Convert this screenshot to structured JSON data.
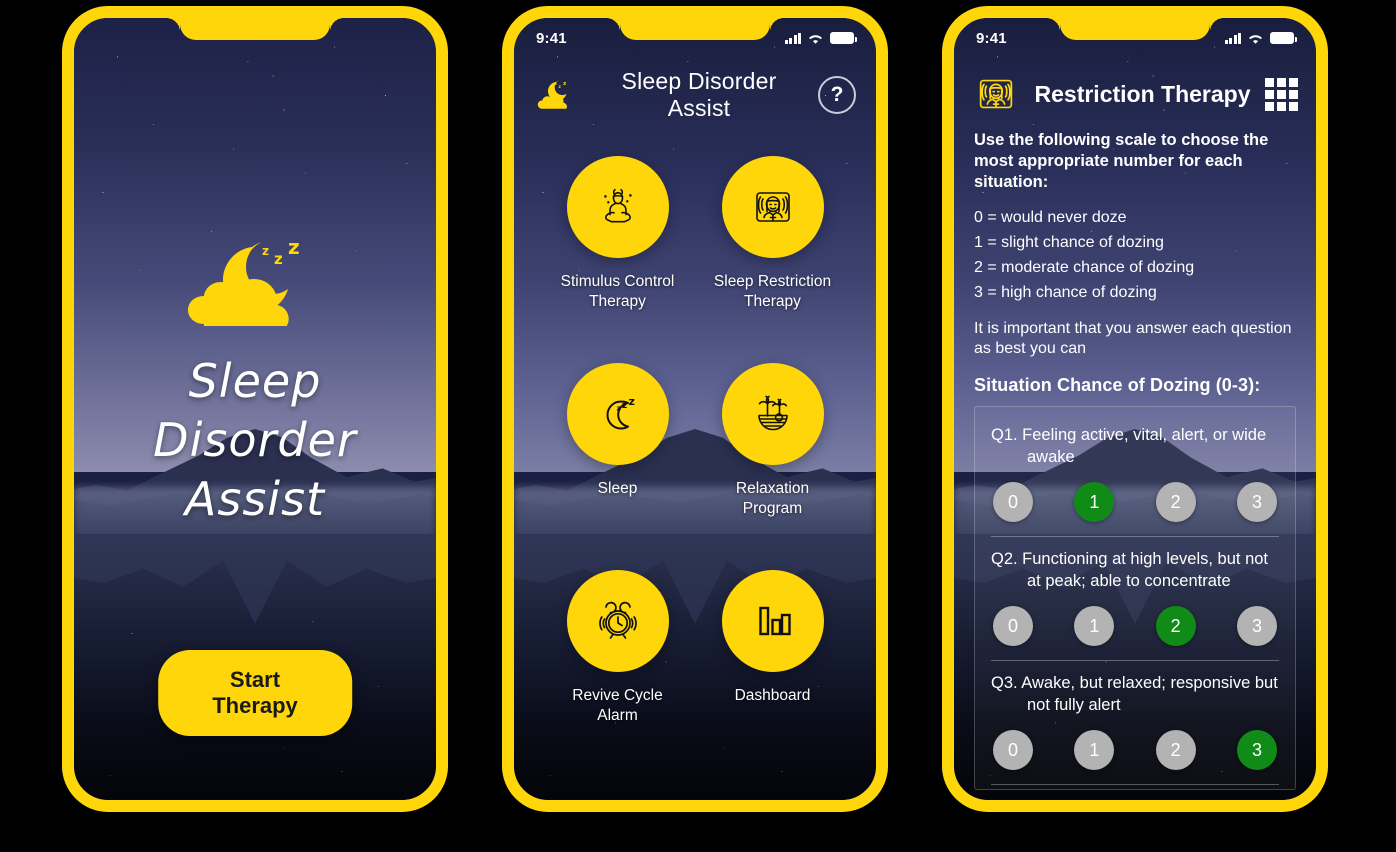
{
  "brand": {
    "yellow": "#FFD60A",
    "green": "#118B18",
    "grey": "#B3B3B3"
  },
  "phone1": {
    "status": {
      "time": "",
      "signal_icon": "signal-bars-icon",
      "wifi_icon": "wifi-icon",
      "battery_icon": "battery-icon"
    },
    "logo_icon": "sleep-cloud-moon-logo",
    "title": "Sleep Disorder\nAssist",
    "title_line1": "Sleep Disorder",
    "title_line2": "Assist",
    "cta_label": "Start Therapy"
  },
  "phone2": {
    "status": {
      "time": "9:41",
      "signal_icon": "signal-bars-icon",
      "wifi_icon": "wifi-icon",
      "battery_icon": "battery-icon"
    },
    "appbar": {
      "logo_icon": "sleep-cloud-moon-logo",
      "title": "Sleep Disorder Assist",
      "help_label": "?"
    },
    "menu": [
      {
        "icon": "meditation-person-icon",
        "label": "Stimulus Control\nTherapy",
        "l1": "Stimulus Control",
        "l2": "Therapy"
      },
      {
        "icon": "sleep-restriction-face-icon",
        "label": "Sleep Restriction\nTherapy",
        "l1": "Sleep Restriction",
        "l2": "Therapy"
      },
      {
        "icon": "moon-zzz-icon",
        "label": "Sleep",
        "l1": "Sleep",
        "l2": ""
      },
      {
        "icon": "palm-tree-sunset-icon",
        "label": "Relaxation\nProgram",
        "l1": "Relaxation",
        "l2": "Program"
      },
      {
        "icon": "alarm-clock-icon",
        "label": "Revive Cycle\nAlarm",
        "l1": "Revive Cycle",
        "l2": "Alarm"
      },
      {
        "icon": "bar-chart-icon",
        "label": "Dashboard",
        "l1": "Dashboard",
        "l2": ""
      }
    ]
  },
  "phone3": {
    "status": {
      "time": "9:41",
      "signal_icon": "signal-bars-icon",
      "wifi_icon": "wifi-icon",
      "battery_icon": "battery-icon"
    },
    "appbar": {
      "icon": "sleep-restriction-face-icon",
      "title": "Restriction Therapy",
      "menu_icon": "grid-menu-icon"
    },
    "intro": "Use the following scale to choose the most appropriate number for each situation:",
    "scale": [
      "0 = would never doze",
      "1 = slight chance of dozing",
      "2 = moderate chance of dozing",
      "3 = high chance of dozing"
    ],
    "note": "It is important that you answer each question as best you can",
    "section_title": "Situation Chance of Dozing (0-3):",
    "questions": [
      {
        "id": "Q1.",
        "text": "Q1. Feeling active, vital, alert, or wide awake",
        "options": [
          "0",
          "1",
          "2",
          "3"
        ],
        "selected": 1
      },
      {
        "id": "Q2.",
        "text": "Q2. Functioning at high levels, but not at peak; able to concentrate",
        "options": [
          "0",
          "1",
          "2",
          "3"
        ],
        "selected": 2
      },
      {
        "id": "Q3.",
        "text": "Q3. Awake, but relaxed; responsive but not fully alert",
        "options": [
          "0",
          "1",
          "2",
          "3"
        ],
        "selected": 3
      }
    ]
  }
}
